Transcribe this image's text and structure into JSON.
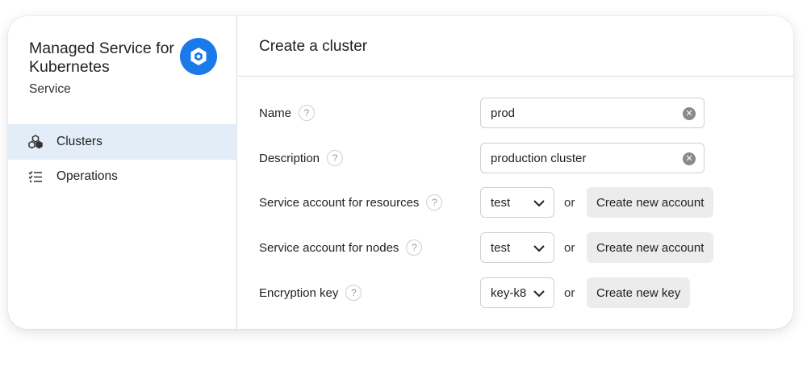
{
  "sidebar": {
    "service_title": "Managed Service for Kubernetes",
    "service_subtitle": "Service",
    "logo_icon": "kubernetes-hexagon-icon",
    "items": [
      {
        "label": "Clusters",
        "icon": "clusters-icon",
        "active": true
      },
      {
        "label": "Operations",
        "icon": "operations-list-icon",
        "active": false
      }
    ]
  },
  "main": {
    "title": "Create a cluster",
    "fields": {
      "name": {
        "label": "Name",
        "value": "prod"
      },
      "description": {
        "label": "Description",
        "value": "production cluster"
      },
      "sa_resources": {
        "label": "Service account for resources",
        "value": "test",
        "or": "or",
        "button": "Create new account"
      },
      "sa_nodes": {
        "label": "Service account for nodes",
        "value": "test",
        "or": "or",
        "button": "Create new account"
      },
      "encryption_key": {
        "label": "Encryption key",
        "value": "key-k8",
        "or": "or",
        "button": "Create new key"
      }
    },
    "help_glyph": "?"
  },
  "colors": {
    "accent": "#1a7ae8",
    "active_nav_bg": "#e3edf7",
    "button_bg": "#ececec",
    "border": "#d0d0d0"
  }
}
